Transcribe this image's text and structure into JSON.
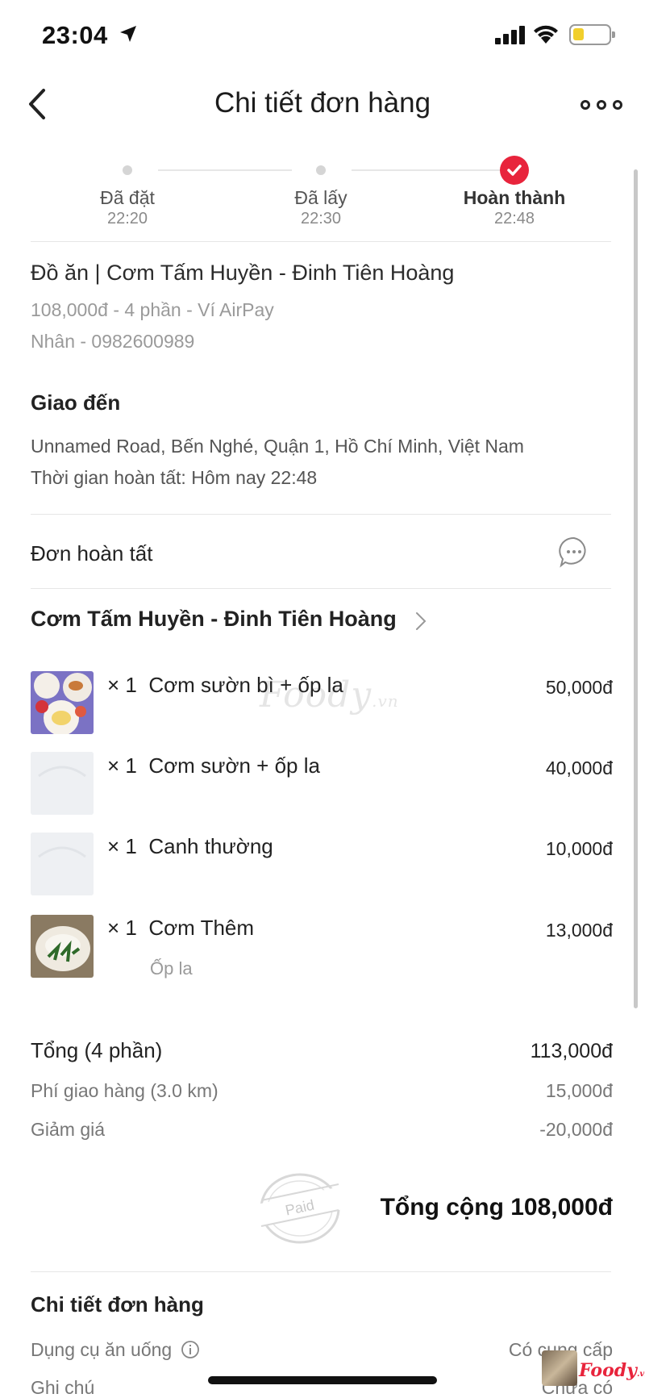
{
  "status_bar": {
    "time": "23:04"
  },
  "nav": {
    "title": "Chi tiết đơn hàng"
  },
  "progress": [
    {
      "label": "Đã đặt",
      "time": "22:20",
      "done": false
    },
    {
      "label": "Đã lấy",
      "time": "22:30",
      "done": false
    },
    {
      "label": "Hoàn thành",
      "time": "22:48",
      "done": true
    }
  ],
  "order_summary": {
    "store_line": "Đồ ăn | Cơm Tấm Huyền - Đinh Tiên Hoàng",
    "payment_line": "108,000đ - 4 phần - Ví AirPay",
    "driver_line": "Nhân - 0982600989"
  },
  "delivery": {
    "title": "Giao đến",
    "address": "Unnamed Road, Bến Nghé, Quận 1, Hồ Chí Minh, Việt Nam",
    "completed_time": "Thời gian hoàn tất: Hôm nay 22:48"
  },
  "status_row": {
    "label": "Đơn hoàn tất"
  },
  "restaurant": {
    "name": "Cơm Tấm Huyền - Đinh Tiên Hoàng"
  },
  "items": [
    {
      "qty": "× 1",
      "name": "Cơm sườn bì + ốp la",
      "price": "50,000đ",
      "note": ""
    },
    {
      "qty": "× 1",
      "name": "Cơm sườn + ốp la",
      "price": "40,000đ",
      "note": ""
    },
    {
      "qty": "× 1",
      "name": "Canh thường",
      "price": "10,000đ",
      "note": ""
    },
    {
      "qty": "× 1",
      "name": "Cơm Thêm",
      "price": "13,000đ",
      "note": "Ốp la"
    }
  ],
  "totals": {
    "subtotal_label": "Tổng (4 phần)",
    "subtotal_value": "113,000đ",
    "shipping_label": "Phí giao hàng (3.0 km)",
    "shipping_value": "15,000đ",
    "discount_label": "Giảm giá",
    "discount_value": "-20,000đ",
    "paid_stamp": "Paid",
    "grand_total": "Tổng cộng 108,000đ"
  },
  "details": {
    "title": "Chi tiết đơn hàng",
    "utensils_label": "Dụng cụ ăn uống",
    "utensils_value": "Có cung cấp",
    "note_label": "Ghi chú",
    "note_value": "Chưa có"
  },
  "watermark": {
    "main": "Foody",
    "suffix": ".vn"
  },
  "brand_badge": {
    "text": "Foody",
    "suffix": ".vn"
  }
}
